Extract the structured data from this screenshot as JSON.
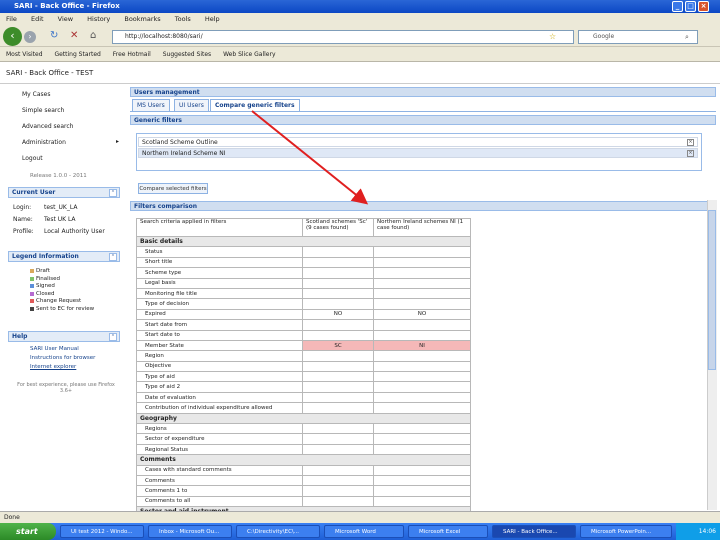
{
  "window": {
    "title": "SARI - Back Office - Firefox",
    "min": "_",
    "max": "□",
    "close": "×"
  },
  "menu": [
    "File",
    "Edit",
    "View",
    "History",
    "Bookmarks",
    "Tools",
    "Help"
  ],
  "nav": {
    "url": "http://localhost:8080/sari/",
    "search_placeholder": "Google"
  },
  "bookmarks": [
    "Most Visited",
    "Getting Started",
    "Free Hotmail",
    "Suggested Sites",
    "Web Slice Gallery"
  ],
  "app": {
    "title": "SARI - Back Office - TEST"
  },
  "sidebar": {
    "links": [
      "My Cases",
      "Simple search",
      "Advanced search",
      "Administration",
      "Logout"
    ],
    "release": "Release 1.0.0 - 2011",
    "current_user": {
      "header": "Current User",
      "login_label": "Login:",
      "login_value": "test_UK_LA",
      "name_label": "Name:",
      "name_value": "Test UK LA",
      "profile_label": "Profile:",
      "profile_value": "Local Authority User"
    },
    "legend": {
      "header": "Legend Information",
      "items": [
        {
          "label": "Draft",
          "color": "#d9a95c"
        },
        {
          "label": "Finalised",
          "color": "#7fc36a"
        },
        {
          "label": "Signed",
          "color": "#5c8fd9"
        },
        {
          "label": "Closed",
          "color": "#b66ad0"
        },
        {
          "label": "Change Request",
          "color": "#e05a5a"
        },
        {
          "label": "Sent to EC for review",
          "color": "#444444"
        }
      ]
    },
    "help": {
      "header": "Help",
      "links": [
        "SARI User Manual",
        "Instructions for browser",
        "Internet explorer"
      ],
      "note": "For best experience, please use Firefox 3.6+"
    }
  },
  "main": {
    "users_header": "Users management",
    "tabs": [
      "MS Users",
      "UI Users",
      "Compare generic filters"
    ],
    "generic_header": "Generic filters",
    "filters": [
      "Scotland Scheme Outline",
      "Northern Ireland Scheme NI"
    ],
    "compare_button": "Compare selected filters",
    "comparison_header": "Filters comparison",
    "table": {
      "headers": [
        "Search criteria applied in filters",
        "Scotland schemes 'Sc' (9 cases found)",
        "Northern Ireland schemes NI (1 case found)"
      ],
      "rows": [
        {
          "type": "group",
          "label": "Basic details"
        },
        {
          "label": "Status",
          "a": "",
          "b": ""
        },
        {
          "label": "Short title",
          "a": "",
          "b": ""
        },
        {
          "label": "Scheme type",
          "a": "",
          "b": ""
        },
        {
          "label": "Legal basis",
          "a": "",
          "b": ""
        },
        {
          "label": "Monitoring file title",
          "a": "",
          "b": ""
        },
        {
          "label": "Type of decision",
          "a": "",
          "b": ""
        },
        {
          "label": "Expired",
          "a": "NO",
          "b": "NO"
        },
        {
          "label": "Start date from",
          "a": "",
          "b": ""
        },
        {
          "label": "Start date to",
          "a": "",
          "b": ""
        },
        {
          "label": "Member State",
          "a": "SC",
          "b": "NI",
          "pink": true
        },
        {
          "label": "Region",
          "a": "",
          "b": ""
        },
        {
          "label": "Objective",
          "a": "",
          "b": ""
        },
        {
          "label": "Type of aid",
          "a": "",
          "b": ""
        },
        {
          "label": "Type of aid 2",
          "a": "",
          "b": ""
        },
        {
          "label": "Date of evaluation",
          "a": "",
          "b": ""
        },
        {
          "label": "Contribution of individual expenditure allowed",
          "a": "",
          "b": ""
        },
        {
          "type": "group",
          "label": "Geography"
        },
        {
          "label": "Regions",
          "a": "",
          "b": ""
        },
        {
          "label": "Sector of expenditure",
          "a": "",
          "b": ""
        },
        {
          "label": "Regional Status",
          "a": "",
          "b": ""
        },
        {
          "type": "group",
          "label": "Comments"
        },
        {
          "label": "Cases with standard comments",
          "a": "",
          "b": ""
        },
        {
          "label": "Comments",
          "a": "",
          "b": ""
        },
        {
          "label": "Comments 1 to",
          "a": "",
          "b": ""
        },
        {
          "label": "Comments to all",
          "a": "",
          "b": ""
        },
        {
          "type": "group",
          "label": "Sector and aid instrument"
        }
      ]
    }
  },
  "status": "Done",
  "taskbar": {
    "start": "start",
    "tasks": [
      "UI test 2012 - Windo...",
      "Inbox - Microsoft Ou...",
      "C:\\Directivity\\EC\\...",
      "Microsoft Word",
      "Microsoft Excel",
      "SARI - Back Office...",
      "Microsoft PowerPoin..."
    ],
    "clock": "14:06"
  }
}
